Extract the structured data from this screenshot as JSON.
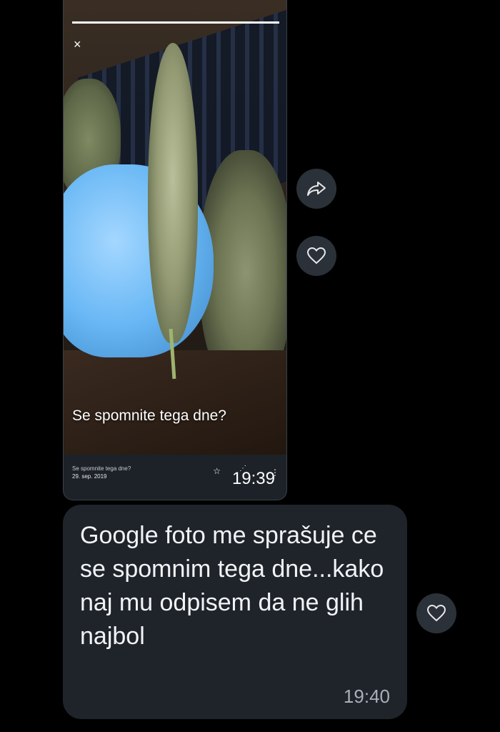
{
  "story": {
    "caption": "Se spomnite tega dne?",
    "notification_title": "Se spomnite tega dne?",
    "notification_date": "29. sep. 2019",
    "close_glyph": "×"
  },
  "shared_message": {
    "time": "19:39"
  },
  "text_message": {
    "text": "Google foto me sprašuje ce se spomnim tega dne...kako naj mu odpisem da ne glih najbol",
    "time": "19:40"
  },
  "icons": {
    "forward": "share-forward-icon",
    "like": "heart-icon",
    "close": "close-icon",
    "star": "star-icon"
  },
  "colors": {
    "background": "#000000",
    "bubble": "#1f242b",
    "round_button": "#2b3138",
    "glove": "#6ab8f5"
  }
}
